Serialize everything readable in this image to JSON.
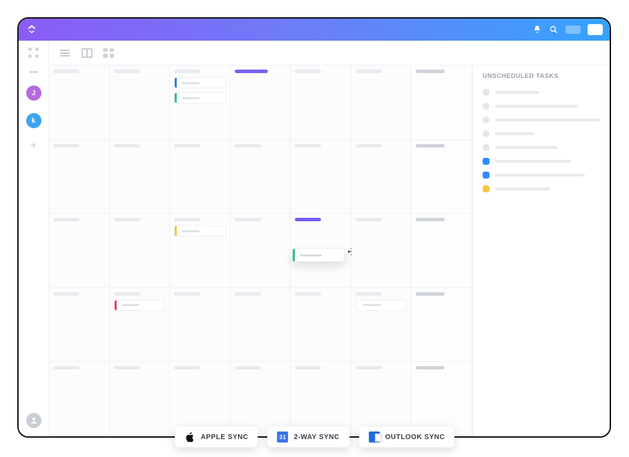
{
  "header": {
    "logo_name": "clickup-logo",
    "notification_icon": "bell-icon",
    "search_icon": "search-icon"
  },
  "sidebar": {
    "users": [
      {
        "initial": "J",
        "color": "j"
      },
      {
        "initial": "k",
        "color": "k"
      }
    ],
    "add_label": "+"
  },
  "toolbar": {
    "views": [
      "list-view",
      "board-view",
      "grid-view"
    ]
  },
  "calendar": {
    "rows": 5,
    "cols": 7,
    "today_col_row0": 3,
    "events": [
      {
        "row": 0,
        "col": 2,
        "color": "#3d73e8"
      },
      {
        "row": 0,
        "col": 2,
        "color": "#2cc28e",
        "second": true
      },
      {
        "row": 2,
        "col": 2,
        "color": "#f6c544"
      },
      {
        "row": 3,
        "col": 1,
        "color": "#e2445c"
      },
      {
        "row": 3,
        "col": 5,
        "color": "#dfe3e8",
        "nostripe": true
      }
    ],
    "dragging_event": {
      "color": "#2cc28e",
      "row": 2,
      "col": 4
    },
    "today2": {
      "row": 2,
      "col": 4
    }
  },
  "side_panel": {
    "title": "UNSCHEDULED TASKS",
    "items": [
      {
        "type": "circle",
        "width": 64
      },
      {
        "type": "circle",
        "width": 120
      },
      {
        "type": "circle",
        "width": 160
      },
      {
        "type": "circle",
        "width": 56
      },
      {
        "type": "circle",
        "width": 90
      },
      {
        "type": "blue",
        "width": 110
      },
      {
        "type": "blue",
        "width": 130
      },
      {
        "type": "yellow",
        "width": 80
      }
    ]
  },
  "sync_bar": {
    "apple": {
      "label": "APPLE SYNC"
    },
    "google": {
      "label": "2-WAY SYNC",
      "badge": "31"
    },
    "outlook": {
      "label": "OUTLOOK SYNC"
    }
  }
}
